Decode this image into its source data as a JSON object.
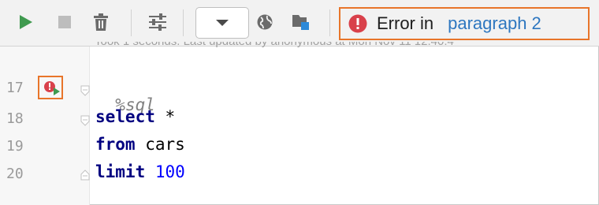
{
  "toolbar": {
    "buttons": [
      "run-icon",
      "stop-icon",
      "trash-icon",
      "settings-sliders-icon",
      "globe-icon",
      "folder-icon"
    ],
    "error": {
      "label": "Error in",
      "link": "paragraph 2"
    }
  },
  "status_line": "Took 1 seconds. Last updated by anonymous at Mon Nov 11 12:40:4",
  "editor": {
    "lines": [
      {
        "number": "17",
        "tokens": [
          {
            "text": "%sql",
            "kind": "magic"
          }
        ]
      },
      {
        "number": "18",
        "tokens": [
          {
            "text": "select",
            "kind": "keyword"
          },
          {
            "text": " *",
            "kind": "plain"
          }
        ]
      },
      {
        "number": "19",
        "tokens": [
          {
            "text": "from",
            "kind": "keyword"
          },
          {
            "text": " cars",
            "kind": "plain"
          }
        ]
      },
      {
        "number": "20",
        "tokens": [
          {
            "text": "limit",
            "kind": "keyword"
          },
          {
            "text": " ",
            "kind": "plain"
          },
          {
            "text": "100",
            "kind": "number"
          }
        ]
      }
    ]
  },
  "colors": {
    "run_green": "#3f9a4f",
    "error_red": "#d9414b",
    "highlight_orange": "#e8752a",
    "link_blue": "#2e77c0",
    "keyword_navy": "#000080"
  }
}
